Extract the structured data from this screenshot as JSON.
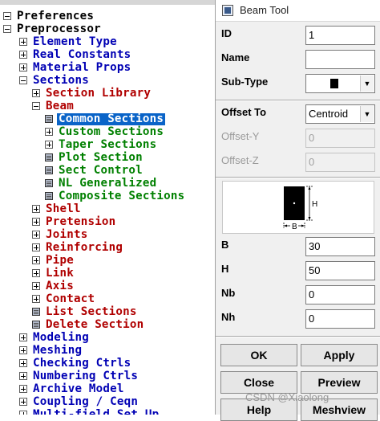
{
  "menu": {
    "items": [
      {
        "label": "Preferences",
        "icon": "minus-box-icon",
        "level": 0,
        "color": "black"
      },
      {
        "label": "Preprocessor",
        "icon": "minus-box-icon",
        "level": 0,
        "color": "black"
      },
      {
        "label": "Element Type",
        "icon": "plus-box-icon",
        "level": 1,
        "color": "blue"
      },
      {
        "label": "Real Constants",
        "icon": "plus-box-icon",
        "level": 1,
        "color": "blue"
      },
      {
        "label": "Material Props",
        "icon": "plus-box-icon",
        "level": 1,
        "color": "blue"
      },
      {
        "label": "Sections",
        "icon": "minus-box-icon",
        "level": 1,
        "color": "blue"
      },
      {
        "label": "Section Library",
        "icon": "plus-box-icon",
        "level": 2,
        "color": "red"
      },
      {
        "label": "Beam",
        "icon": "minus-box-icon",
        "level": 2,
        "color": "red"
      },
      {
        "label": "Common Sections",
        "icon": "function-leaf-icon",
        "level": 3,
        "color": "green",
        "selected": true
      },
      {
        "label": "Custom Sections",
        "icon": "plus-box-icon",
        "level": 3,
        "color": "green"
      },
      {
        "label": "Taper Sections",
        "icon": "plus-box-icon",
        "level": 3,
        "color": "green"
      },
      {
        "label": "Plot Section",
        "icon": "function-leaf-icon",
        "level": 3,
        "color": "green"
      },
      {
        "label": "Sect Control",
        "icon": "function-leaf-icon",
        "level": 3,
        "color": "green"
      },
      {
        "label": "NL Generalized",
        "icon": "function-leaf-icon",
        "level": 3,
        "color": "green"
      },
      {
        "label": "Composite Sections",
        "icon": "function-leaf-icon",
        "level": 3,
        "color": "green"
      },
      {
        "label": "Shell",
        "icon": "plus-box-icon",
        "level": 2,
        "color": "red"
      },
      {
        "label": "Pretension",
        "icon": "plus-box-icon",
        "level": 2,
        "color": "red"
      },
      {
        "label": "Joints",
        "icon": "plus-box-icon",
        "level": 2,
        "color": "red"
      },
      {
        "label": "Reinforcing",
        "icon": "plus-box-icon",
        "level": 2,
        "color": "red"
      },
      {
        "label": "Pipe",
        "icon": "plus-box-icon",
        "level": 2,
        "color": "red"
      },
      {
        "label": "Link",
        "icon": "plus-box-icon",
        "level": 2,
        "color": "red"
      },
      {
        "label": "Axis",
        "icon": "plus-box-icon",
        "level": 2,
        "color": "red"
      },
      {
        "label": "Contact",
        "icon": "plus-box-icon",
        "level": 2,
        "color": "red"
      },
      {
        "label": "List Sections",
        "icon": "function-leaf-icon",
        "level": 2,
        "color": "red"
      },
      {
        "label": "Delete Section",
        "icon": "function-leaf-icon",
        "level": 2,
        "color": "red"
      },
      {
        "label": "Modeling",
        "icon": "plus-box-icon",
        "level": 1,
        "color": "blue"
      },
      {
        "label": "Meshing",
        "icon": "plus-box-icon",
        "level": 1,
        "color": "blue"
      },
      {
        "label": "Checking Ctrls",
        "icon": "plus-box-icon",
        "level": 1,
        "color": "blue"
      },
      {
        "label": "Numbering Ctrls",
        "icon": "plus-box-icon",
        "level": 1,
        "color": "blue"
      },
      {
        "label": "Archive Model",
        "icon": "plus-box-icon",
        "level": 1,
        "color": "blue"
      },
      {
        "label": "Coupling / Ceqn",
        "icon": "plus-box-icon",
        "level": 1,
        "color": "blue"
      },
      {
        "label": "Multi-field Set Up",
        "icon": "plus-box-icon",
        "level": 1,
        "color": "blue"
      }
    ]
  },
  "dialog": {
    "title": "Beam Tool",
    "fields": {
      "id": {
        "label": "ID",
        "value": "1"
      },
      "name": {
        "label": "Name",
        "value": ""
      },
      "subtype": {
        "label": "Sub-Type",
        "value_icon": "solid-rectangle-icon"
      },
      "offset_to": {
        "label": "Offset To",
        "value": "Centroid"
      },
      "offset_y": {
        "label": "Offset-Y",
        "value": "0"
      },
      "offset_z": {
        "label": "Offset-Z",
        "value": "0"
      },
      "b": {
        "label": "B",
        "value": "30"
      },
      "h": {
        "label": "H",
        "value": "50"
      },
      "nb": {
        "label": "Nb",
        "value": "0"
      },
      "nh": {
        "label": "Nh",
        "value": "0"
      }
    },
    "preview": {
      "b_label": "B",
      "h_label": "H"
    },
    "buttons": {
      "ok": "OK",
      "apply": "Apply",
      "close": "Close",
      "preview": "Preview",
      "help": "Help",
      "meshview": "Meshview"
    }
  },
  "watermark": "CSDN @Xiaolong",
  "colors": {
    "black": "#000000",
    "blue": "#0000b4",
    "red": "#b00000",
    "green": "#008000",
    "selection": "#0a64c8",
    "dialog_bg": "#f0f0f0"
  }
}
